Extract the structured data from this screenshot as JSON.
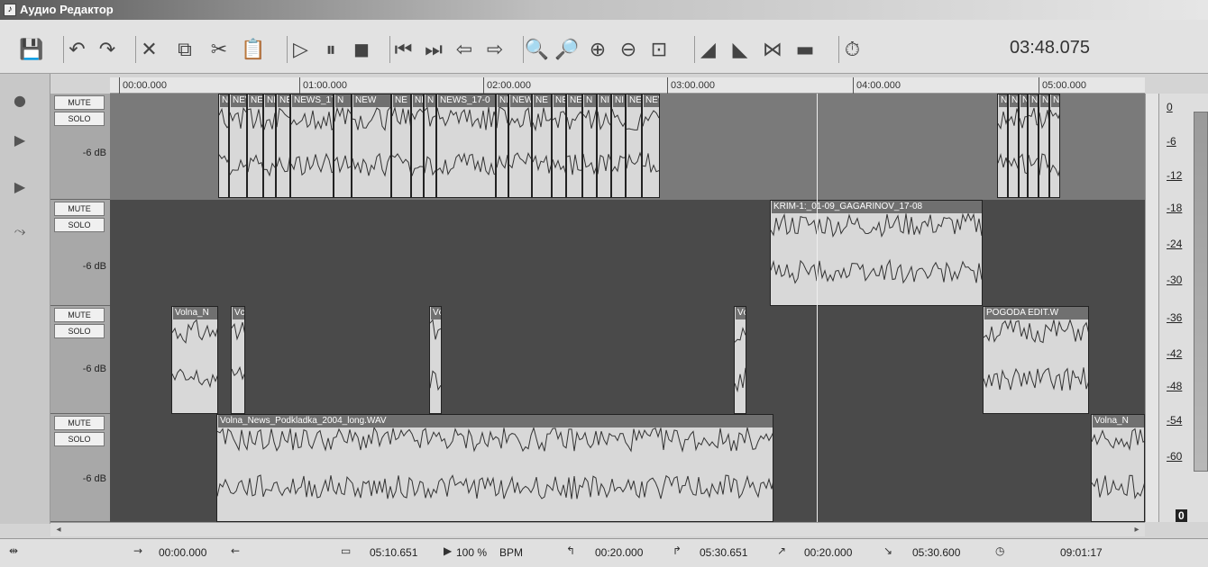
{
  "app": {
    "title": "Аудио Редактор"
  },
  "toolbar": {
    "time": "03:48.075",
    "icons": [
      "save-icon",
      "undo-icon",
      "redo-icon",
      "delete-icon",
      "copy-icon",
      "cut-icon",
      "paste-icon",
      "play-icon",
      "pause-icon",
      "stop-icon",
      "go-start-icon",
      "go-end-icon",
      "prev-icon",
      "next-icon",
      "zoom-selection-icon",
      "zoom-fit-icon",
      "zoom-in-icon",
      "zoom-out-icon",
      "zoom-reset-icon",
      "fade-in-icon",
      "fade-out-icon",
      "crossfade-icon",
      "normalize-icon",
      "timer-icon"
    ]
  },
  "timeline": {
    "ticks": [
      "00:00.000",
      "01:00.000",
      "02:00.000",
      "03:00.000",
      "04:00.000",
      "05:00.000"
    ]
  },
  "tracks": [
    {
      "mute": "MUTE",
      "solo": "SOLO",
      "gain": "-6 dB"
    },
    {
      "mute": "MUTE",
      "solo": "SOLO",
      "gain": "-6 dB"
    },
    {
      "mute": "MUTE",
      "solo": "SOLO",
      "gain": "-6 dB"
    },
    {
      "mute": "MUTE",
      "solo": "SOLO",
      "gain": "-6 dB"
    }
  ],
  "clips": {
    "track1": [
      "NE",
      "NEV",
      "NE",
      "NI",
      "NEV",
      "NEWS_17",
      "N",
      "NEW",
      "NE",
      "NE",
      "N",
      "NEWS_17-0",
      "NE",
      "NEW",
      "NE",
      "NE",
      "NE",
      "N",
      "NI",
      "NI",
      "NE",
      "NEV",
      "N",
      "N",
      "N",
      "N",
      "N",
      "N"
    ],
    "track2_label": "KRIM-1:_01-09_GAGARINOV_17-08",
    "track3": [
      "Volna_N",
      "Vc",
      "Vc",
      "Vc",
      "POGODA EDIT.W"
    ],
    "track4_label": "Volna_News_Podkladka_2004_long.WAV",
    "track4_right": "Volna_N"
  },
  "meter": {
    "labels": [
      "0",
      "-6",
      "-12",
      "-18",
      "-24",
      "-30",
      "-36",
      "-42",
      "-48",
      "-54",
      "-60"
    ],
    "volume": "0"
  },
  "status": {
    "start": "00:00.000",
    "length": "05:10.651",
    "zoom": "100 %",
    "bpm": "BPM",
    "sel_start": "00:20.000",
    "sel_end": "05:30.651",
    "loop_start": "00:20.000",
    "loop_end": "05:30.600",
    "total": "09:01:17"
  }
}
